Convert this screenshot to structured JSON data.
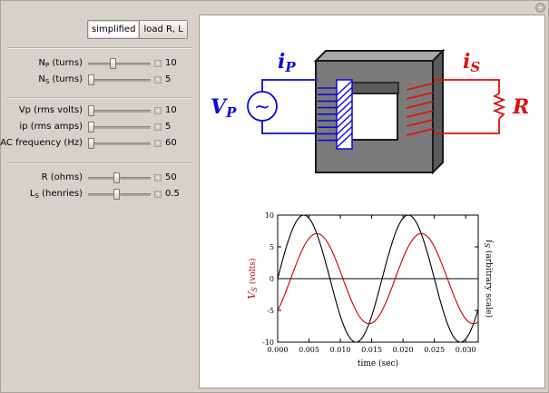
{
  "mode_toggle": {
    "options": [
      "simplified",
      "load R, L"
    ],
    "active": "simplified"
  },
  "controls": [
    {
      "id": "np",
      "label": "N",
      "sub": "P",
      "suffix": " (turns)",
      "value": "10",
      "fraction": 0.38
    },
    {
      "id": "ns",
      "label": "N",
      "sub": "S",
      "suffix": " (turns)",
      "value": "5",
      "fraction": 0.0
    },
    {
      "id": "vp",
      "label": "Vp (rms volts)",
      "sub": "",
      "suffix": "",
      "value": "10",
      "fraction": 0.0
    },
    {
      "id": "ip",
      "label": "ip (rms amps)",
      "sub": "",
      "suffix": "",
      "value": "5",
      "fraction": 0.0
    },
    {
      "id": "freq",
      "label": "AC frequency (Hz)",
      "sub": "",
      "suffix": "",
      "value": "60",
      "fraction": 0.0
    },
    {
      "id": "r",
      "label": "R (ohms)",
      "sub": "",
      "suffix": "",
      "value": "50",
      "fraction": 0.45
    },
    {
      "id": "ls",
      "label": "L",
      "sub": "S",
      "suffix": " (henries)",
      "value": "0.5",
      "fraction": 0.45
    }
  ],
  "diagram": {
    "primary_current": "i",
    "primary_current_sub": "P",
    "primary_voltage": "V",
    "primary_voltage_sub": "P",
    "secondary_current": "i",
    "secondary_current_sub": "S",
    "load": "R",
    "source_symbol": "~"
  },
  "chart_data": {
    "type": "line",
    "xlabel": "time (sec)",
    "ylabel_left": "V",
    "ylabel_left_sub": "S",
    "ylabel_left_suffix": " (volts)",
    "ylabel_right": "i",
    "ylabel_right_sub": "S",
    "ylabel_right_suffix": " (arbitrary scale)",
    "xlim": [
      0,
      0.032
    ],
    "ylim": [
      -10,
      10
    ],
    "x_ticks": [
      "0.000",
      "0.005",
      "0.010",
      "0.015",
      "0.020",
      "0.025",
      "0.030"
    ],
    "y_ticks": [
      "10",
      "5",
      "0",
      "-5",
      "-10"
    ],
    "frequency_hz": 60,
    "series": [
      {
        "color": "#000000",
        "amplitude": 10,
        "phase_deg": 0
      },
      {
        "color": "#cc0000",
        "amplitude": 7.1,
        "phase_deg": -45
      }
    ]
  },
  "colors": {
    "primary": "#0a0ad8",
    "secondary": "#e01010",
    "core": "#7a7a7a",
    "core_edge": "#1a1a1a"
  }
}
